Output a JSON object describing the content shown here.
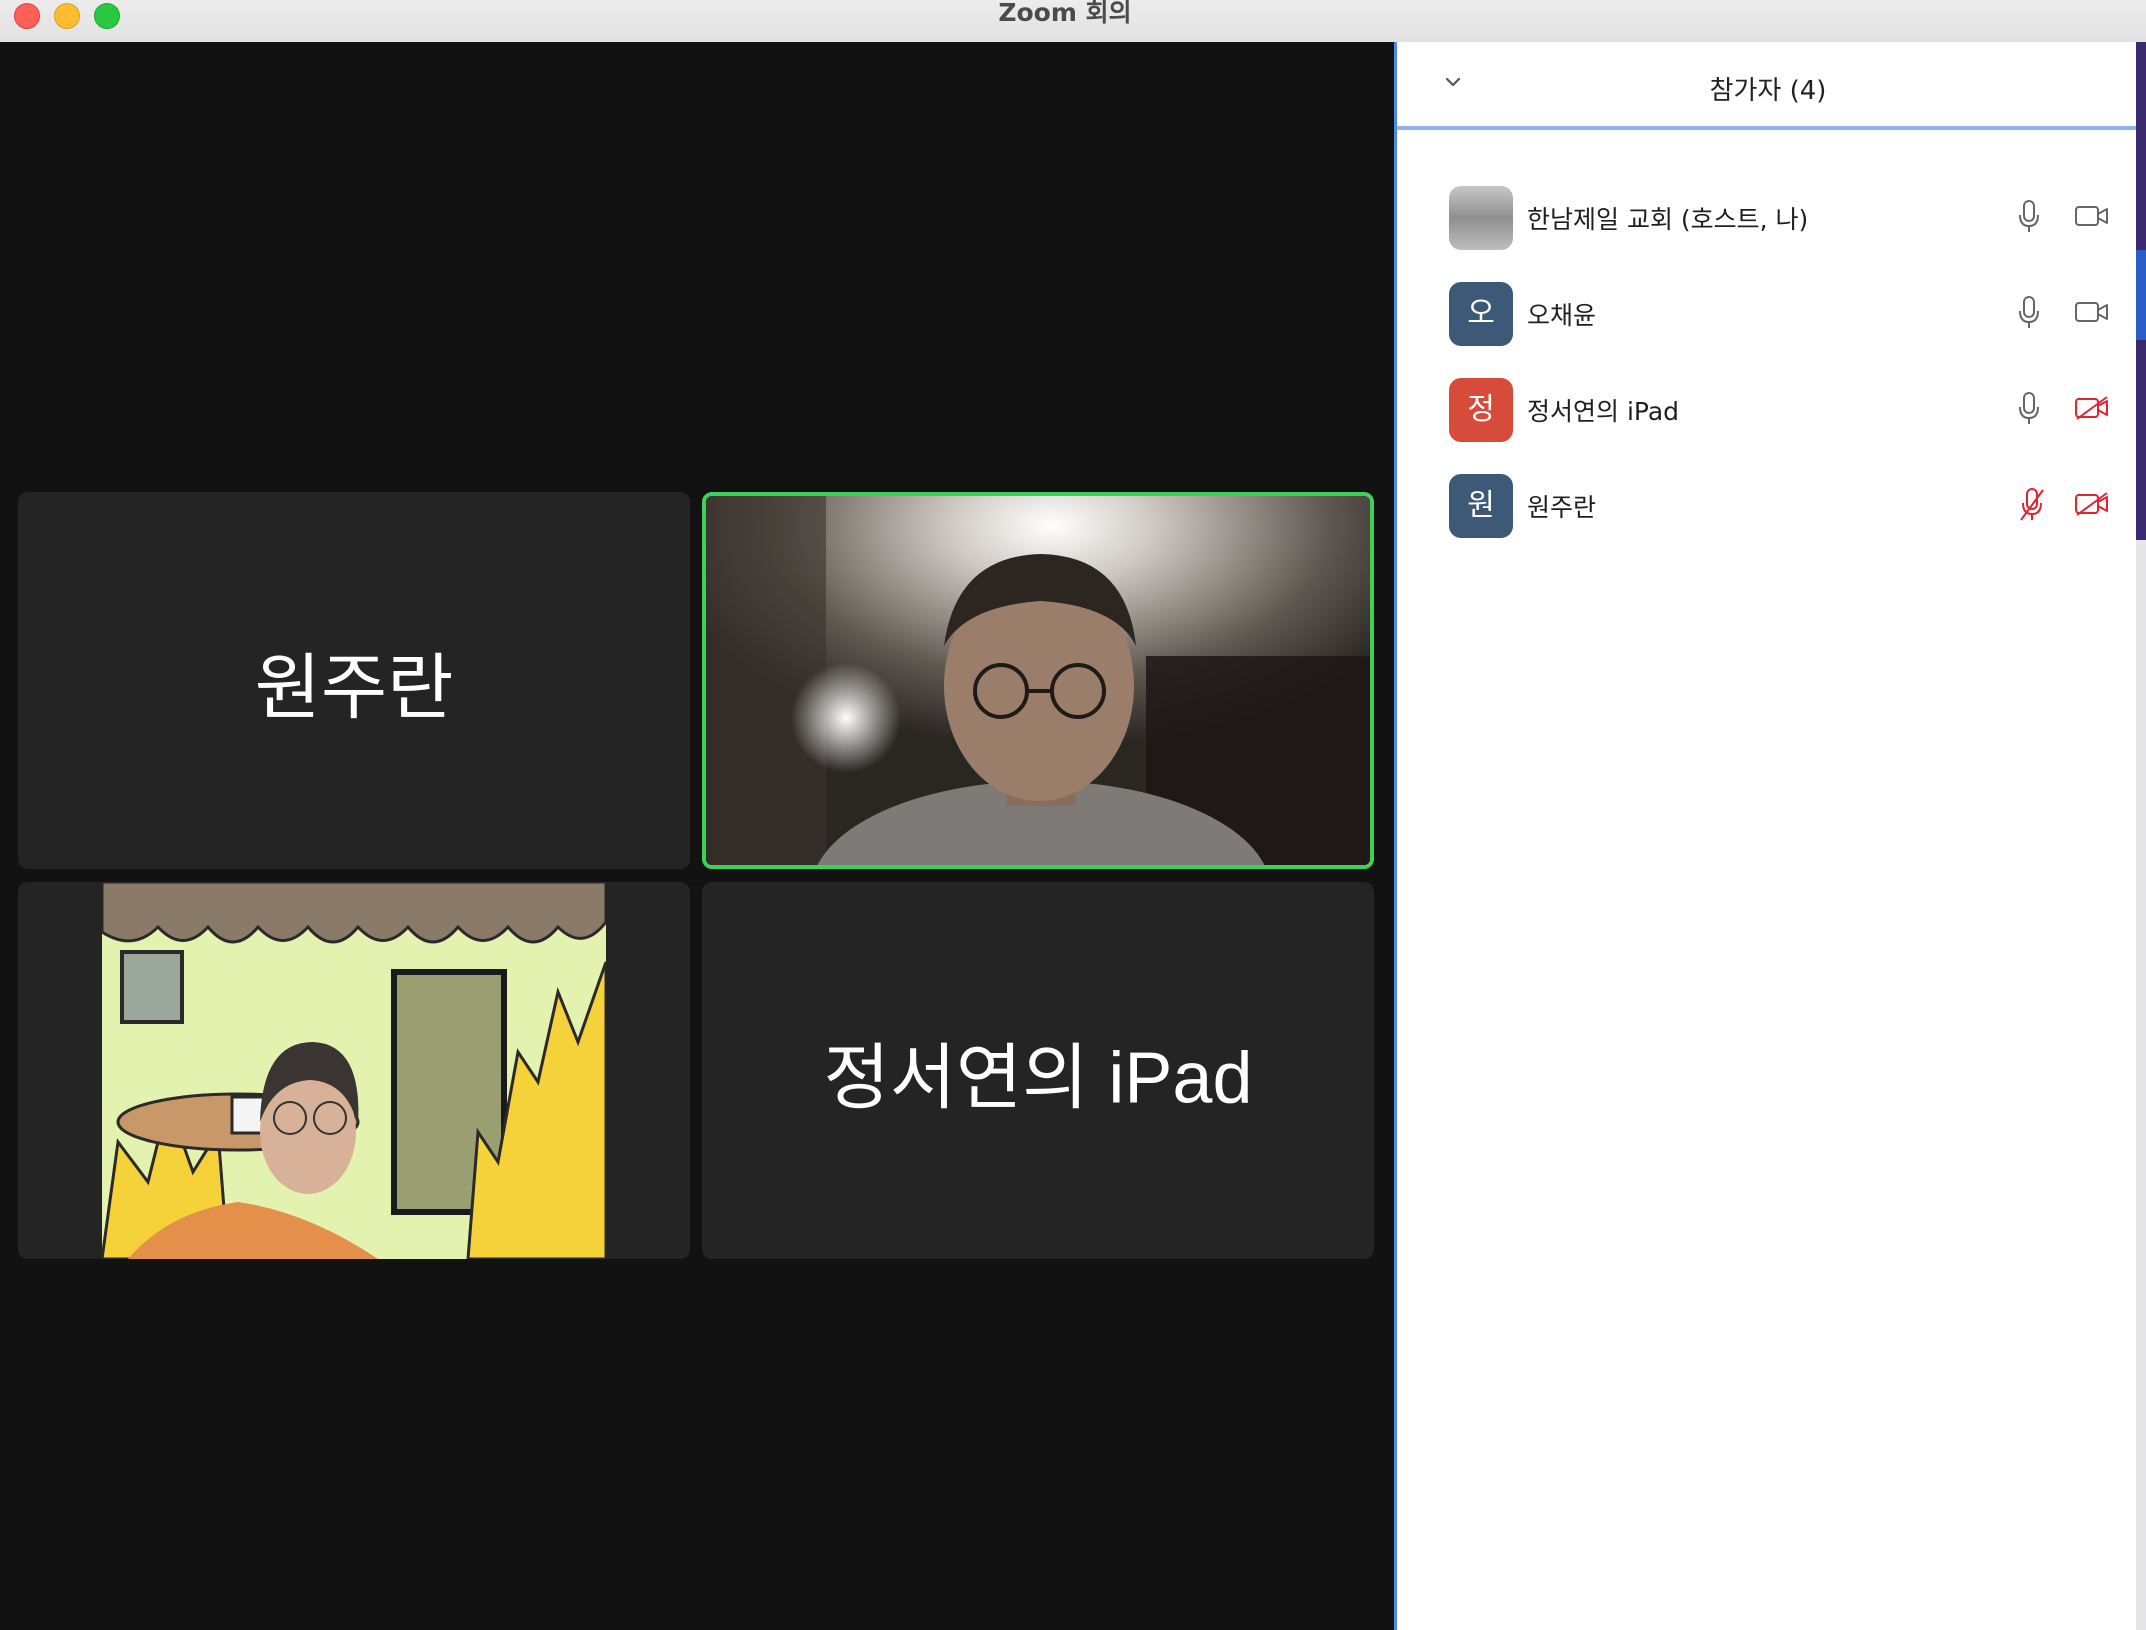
{
  "window": {
    "title": "Zoom 회의"
  },
  "video_tiles": [
    {
      "name": "원주란",
      "video": false
    },
    {
      "name": "",
      "video": true,
      "active_speaker": true
    },
    {
      "name": "",
      "video": true
    },
    {
      "name": "정서연의 iPad",
      "video": false
    }
  ],
  "participants_panel": {
    "title": "참가자 (4)",
    "participants": [
      {
        "name": "한남제일 교회 (호스트, 나)",
        "avatar_text": "",
        "avatar_color": "#9a9a9a",
        "mic": "on",
        "camera": "on"
      },
      {
        "name": "오채윤",
        "avatar_text": "오",
        "avatar_color": "#3c5a78",
        "mic": "on",
        "camera": "on"
      },
      {
        "name": "정서연의 iPad",
        "avatar_text": "정",
        "avatar_color": "#d64b3a",
        "mic": "on",
        "camera": "off"
      },
      {
        "name": "원주란",
        "avatar_text": "원",
        "avatar_color": "#3c5a78",
        "mic": "off",
        "camera": "off"
      }
    ]
  },
  "colors": {
    "active_speaker_border": "#3dd15a",
    "muted_red": "#e0242f",
    "panel_accent": "#4d8ae6"
  }
}
